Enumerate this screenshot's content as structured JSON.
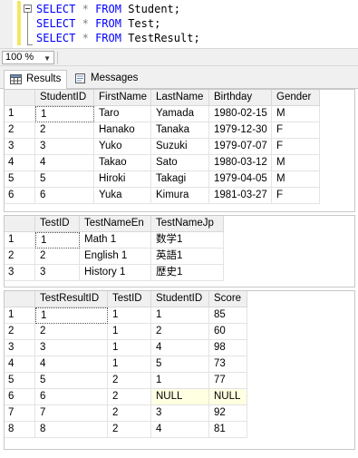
{
  "editor": {
    "lines": [
      {
        "kw1": "SELECT",
        "star": "*",
        "kw2": "FROM",
        "table": "Student;"
      },
      {
        "kw1": "SELECT",
        "star": "*",
        "kw2": "FROM",
        "table": "Test;"
      },
      {
        "kw1": "SELECT",
        "star": "*",
        "kw2": "FROM",
        "table": "TestResult;"
      }
    ]
  },
  "zoom": {
    "value": "100 %"
  },
  "tabs": [
    {
      "label": "Results",
      "icon": "grid-icon",
      "active": true
    },
    {
      "label": "Messages",
      "icon": "messages-icon",
      "active": false
    }
  ],
  "grids": [
    {
      "columns": [
        "StudentID",
        "FirstName",
        "LastName",
        "Birthday",
        "Gender"
      ],
      "rows": [
        [
          "1",
          "1",
          "Taro",
          "Yamada",
          "1980-02-15",
          "M"
        ],
        [
          "2",
          "2",
          "Hanako",
          "Tanaka",
          "1979-12-30",
          "F"
        ],
        [
          "3",
          "3",
          "Yuko",
          "Suzuki",
          "1979-07-07",
          "F"
        ],
        [
          "4",
          "4",
          "Takao",
          "Sato",
          "1980-03-12",
          "M"
        ],
        [
          "5",
          "5",
          "Hiroki",
          "Takagi",
          "1979-04-05",
          "M"
        ],
        [
          "6",
          "6",
          "Yuka",
          "Kimura",
          "1981-03-27",
          "F"
        ]
      ]
    },
    {
      "columns": [
        "TestID",
        "TestNameEn",
        "TestNameJp"
      ],
      "rows": [
        [
          "1",
          "1",
          "Math 1",
          "数学1"
        ],
        [
          "2",
          "2",
          "English 1",
          "英語1"
        ],
        [
          "3",
          "3",
          "History 1",
          "歴史1"
        ]
      ]
    },
    {
      "columns": [
        "TestResultID",
        "TestID",
        "StudentID",
        "Score"
      ],
      "rows": [
        [
          "1",
          "1",
          "1",
          "1",
          "85"
        ],
        [
          "2",
          "2",
          "1",
          "2",
          "60"
        ],
        [
          "3",
          "3",
          "1",
          "4",
          "98"
        ],
        [
          "4",
          "4",
          "1",
          "5",
          "73"
        ],
        [
          "5",
          "5",
          "2",
          "1",
          "77"
        ],
        [
          "6",
          "6",
          "2",
          "NULL",
          "NULL"
        ],
        [
          "7",
          "7",
          "2",
          "3",
          "92"
        ],
        [
          "8",
          "8",
          "2",
          "4",
          "81"
        ]
      ]
    }
  ]
}
